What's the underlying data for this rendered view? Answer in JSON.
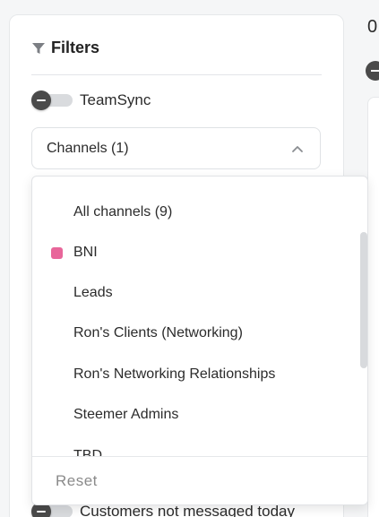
{
  "filters": {
    "title": "Filters",
    "icon": "funnel-icon"
  },
  "teamsync_toggle": {
    "label": "TeamSync",
    "on": false
  },
  "channels_select": {
    "value": "Channels (1)",
    "expanded": true
  },
  "dropdown": {
    "options": [
      {
        "label": "All channels (9)",
        "color": null
      },
      {
        "label": "BNI",
        "color": "#e8669a"
      },
      {
        "label": "Leads",
        "color": null
      },
      {
        "label": "Ron's Clients (Networking)",
        "color": null
      },
      {
        "label": "Ron's Networking Relationships",
        "color": null
      },
      {
        "label": "Steemer Admins",
        "color": null
      },
      {
        "label": "TBD",
        "color": null
      }
    ],
    "reset_label": "Reset"
  },
  "customers_toggle": {
    "label": "Customers not messaged today",
    "on": false
  },
  "right_panel": {
    "partial_text": "0"
  }
}
